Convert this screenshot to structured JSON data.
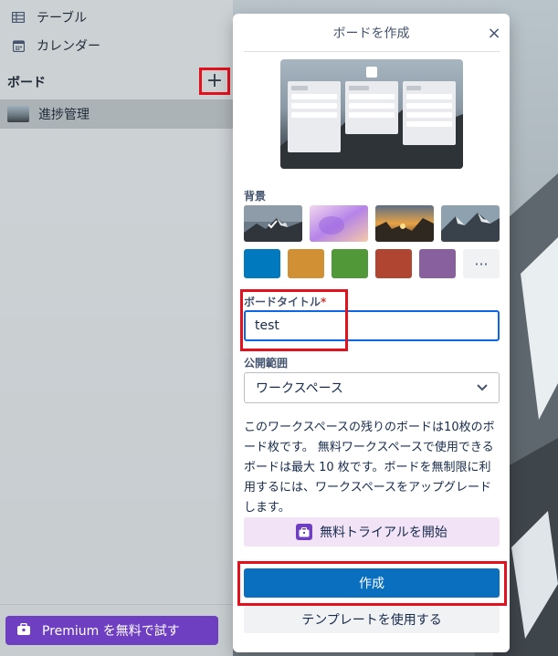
{
  "sidebar": {
    "items": [
      {
        "label": "テーブル",
        "icon": "table-icon"
      },
      {
        "label": "カレンダー",
        "icon": "calendar-icon"
      }
    ],
    "boards_header": "ボード",
    "add_board_label": "+",
    "boards": [
      {
        "label": "進捗管理"
      }
    ],
    "premium_label": "Premium を無料で試す"
  },
  "dialog": {
    "title": "ボードを作成",
    "close_label": "×",
    "background_label": "背景",
    "background_photos": [
      "mountain-lake",
      "gradient-purple",
      "canyon-sunset",
      "snowy-mountain"
    ],
    "background_colors": [
      "#0079bf",
      "#d29034",
      "#519839",
      "#b04632",
      "#89609e"
    ],
    "more_label": "···",
    "board_title_label": "ボードタイトル",
    "required_mark": "*",
    "board_title_value": "test",
    "visibility_label": "公開範囲",
    "visibility_value": "ワークスペース",
    "info_text": "このワークスペースの残りのボードは10枚のボード枚です。 無料ワークスペースで使用できるボードは最大 10 枚です。ボードを無制限に利用するには、ワークスペースをアップグレードします。",
    "trial_label": "無料トライアルを開始",
    "create_label": "作成",
    "template_label": "テンプレートを使用する"
  },
  "colors": {
    "accent": "#0a6fbf",
    "premium": "#6e3fc0",
    "highlight": "#e3101e"
  }
}
